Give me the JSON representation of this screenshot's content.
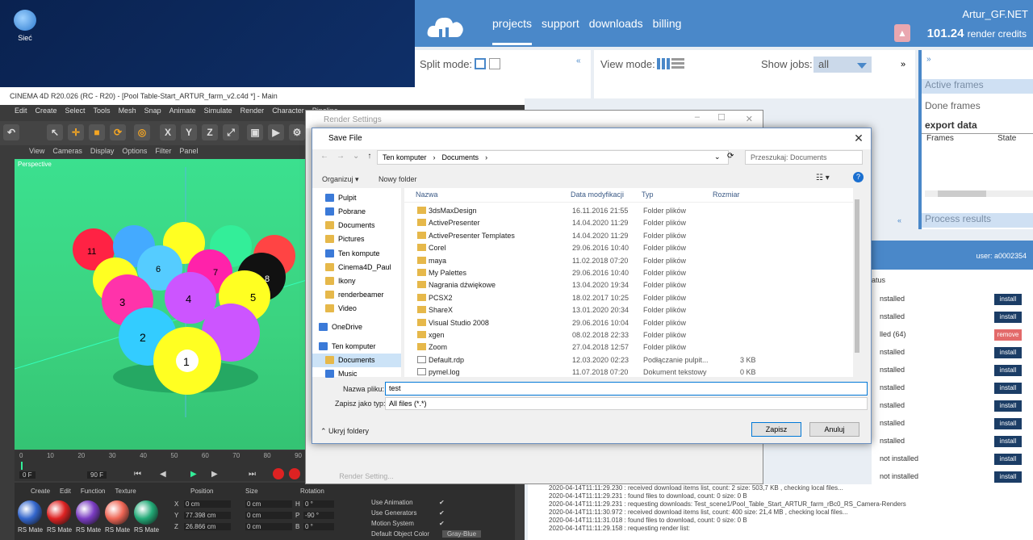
{
  "desktop": {
    "icon_label": "Sieć"
  },
  "web": {
    "nav": [
      "projects",
      "support",
      "downloads",
      "billing"
    ],
    "user": "Artur_GF.NET",
    "credits_value": "101.24",
    "credits_label": "render credits",
    "split_mode_label": "Split mode:",
    "view_mode_label": "View mode:",
    "show_jobs_label": "Show jobs:",
    "show_jobs_value": "all",
    "active_frames": "Active frames",
    "done_frames": "Done frames",
    "export_data": "export data",
    "frames_col": "Frames",
    "state_col": "State",
    "process_results": "Process results",
    "users_user": "user: a0002354",
    "status_col": "atus",
    "user_rows": [
      {
        "status": "nstalled",
        "action": "install"
      },
      {
        "status": "nstalled",
        "action": "install"
      },
      {
        "status": "lled (64)",
        "action": "remove"
      },
      {
        "status": "nstalled",
        "action": "install"
      },
      {
        "status": "nstalled",
        "action": "install"
      },
      {
        "status": "nstalled",
        "action": "install"
      },
      {
        "status": "nstalled",
        "action": "install"
      },
      {
        "status": "nstalled",
        "action": "install"
      },
      {
        "status": "nstalled",
        "action": "install"
      },
      {
        "status": "not installed",
        "action": "install"
      },
      {
        "status": "not installed",
        "action": "install"
      }
    ],
    "log": [
      "2020-04-14T11:11:29.230 : received download items list, count: 2 size: 503,7 KB , checking local files...",
      "2020-04-14T11:11:29.231 : found files to download, count: 0 size: 0 B",
      "2020-04-14T11:11:29.231 : requesting downloads: Test_scene1/Pool_Table_Start_ARTUR_farm_rBc0_RS_Camera-Renders",
      "2020-04-14T11:11:30.972 : received download items list, count: 400 size: 21,4 MB , checking local files...",
      "2020-04-14T11:11:31.018 : found files to download, count: 0 size: 0 B",
      "2020-04-14T11:11:29.158 : requesting render list:"
    ]
  },
  "c4d": {
    "title": "CINEMA 4D R20.026 (RC - R20) - [Pool Table-Start_ARTUR_farm_v2.c4d *] - Main",
    "menu": [
      "Edit",
      "Create",
      "Select",
      "Tools",
      "Mesh",
      "Snap",
      "Animate",
      "Simulate",
      "Render",
      "Character",
      "Pipeline"
    ],
    "viewport_menu": [
      "View",
      "Cameras",
      "Display",
      "Options",
      "Filter",
      "Panel"
    ],
    "viewport_label": "Perspective",
    "ticks": [
      "0",
      "10",
      "20",
      "30",
      "40",
      "50",
      "60",
      "70",
      "80",
      "90"
    ],
    "frame_start": "0 F",
    "frame_end": "90 F",
    "bottom_menu": [
      "Create",
      "Edit",
      "Function",
      "Texture"
    ],
    "materials": [
      "RS Mate",
      "RS Mate",
      "RS Mate",
      "RS Mate",
      "RS Mate"
    ],
    "coords_headers": [
      "Position",
      "Size",
      "Rotation"
    ],
    "coords": [
      {
        "axis": "X",
        "pos": "0 cm",
        "size": "0 cm",
        "rot": "H",
        "rotv": "0 °"
      },
      {
        "axis": "Y",
        "pos": "77.398 cm",
        "size": "0 cm",
        "rot": "P",
        "rotv": "-90 °"
      },
      {
        "axis": "Z",
        "pos": "26.866 cm",
        "size": "0 cm",
        "rot": "B",
        "rotv": "0 °"
      }
    ],
    "attrs": [
      "Use Animation",
      "Use Generators",
      "Motion System",
      "Default Object Color"
    ],
    "default_color_value": "Gray-Blue"
  },
  "render_settings": {
    "title": "Render Settings",
    "button": "Render Setting..."
  },
  "dialog": {
    "title": "Save File",
    "path": [
      "Ten komputer",
      "Documents"
    ],
    "search_placeholder": "Przeszukaj: Documents",
    "organize": "Organizuj ▾",
    "new_folder": "Nowy folder",
    "columns": {
      "name": "Nazwa",
      "date": "Data modyfikacji",
      "type": "Typ",
      "size": "Rozmiar"
    },
    "nav_items": [
      {
        "label": "Pulpit",
        "icon": "blue"
      },
      {
        "label": "Pobrane",
        "icon": "blue"
      },
      {
        "label": "Documents",
        "icon": "doc"
      },
      {
        "label": "Pictures",
        "icon": "doc"
      },
      {
        "label": "Ten kompute",
        "icon": "blue"
      },
      {
        "label": "Cinema4D_Paul",
        "icon": "folder"
      },
      {
        "label": "Ikony",
        "icon": "folder"
      },
      {
        "label": "renderbeamer",
        "icon": "folder"
      },
      {
        "label": "Video",
        "icon": "folder"
      },
      {
        "label": "OneDrive",
        "icon": "blue"
      },
      {
        "label": "Ten komputer",
        "icon": "blue"
      },
      {
        "label": "Documents",
        "icon": "doc"
      },
      {
        "label": "Music",
        "icon": "blue"
      }
    ],
    "files": [
      {
        "name": "3dsMaxDesign",
        "date": "16.11.2016 21:55",
        "type": "Folder plików",
        "size": "",
        "kind": "folder"
      },
      {
        "name": "ActivePresenter",
        "date": "14.04.2020 11:29",
        "type": "Folder plików",
        "size": "",
        "kind": "folder"
      },
      {
        "name": "ActivePresenter Templates",
        "date": "14.04.2020 11:29",
        "type": "Folder plików",
        "size": "",
        "kind": "folder"
      },
      {
        "name": "Corel",
        "date": "29.06.2016 10:40",
        "type": "Folder plików",
        "size": "",
        "kind": "folder"
      },
      {
        "name": "maya",
        "date": "11.02.2018 07:20",
        "type": "Folder plików",
        "size": "",
        "kind": "folder"
      },
      {
        "name": "My Palettes",
        "date": "29.06.2016 10:40",
        "type": "Folder plików",
        "size": "",
        "kind": "folder"
      },
      {
        "name": "Nagrania dźwiękowe",
        "date": "13.04.2020 19:34",
        "type": "Folder plików",
        "size": "",
        "kind": "folder"
      },
      {
        "name": "PCSX2",
        "date": "18.02.2017 10:25",
        "type": "Folder plików",
        "size": "",
        "kind": "folder"
      },
      {
        "name": "ShareX",
        "date": "13.01.2020 20:34",
        "type": "Folder plików",
        "size": "",
        "kind": "folder"
      },
      {
        "name": "Visual Studio 2008",
        "date": "29.06.2016 10:04",
        "type": "Folder plików",
        "size": "",
        "kind": "folder"
      },
      {
        "name": "xgen",
        "date": "08.02.2018 22:33",
        "type": "Folder plików",
        "size": "",
        "kind": "folder"
      },
      {
        "name": "Zoom",
        "date": "27.04.2018 12:57",
        "type": "Folder plików",
        "size": "",
        "kind": "folder"
      },
      {
        "name": "Default.rdp",
        "date": "12.03.2020 02:23",
        "type": "Podłączanie pulpit...",
        "size": "3 KB",
        "kind": "doc"
      },
      {
        "name": "pymel.log",
        "date": "11.07.2018 07:20",
        "type": "Dokument tekstowy",
        "size": "0 KB",
        "kind": "doc"
      }
    ],
    "filename_label": "Nazwa pliku:",
    "filename_value": "test",
    "filetype_label": "Zapisz jako typ:",
    "filetype_value": "All files (*.*)",
    "hide_folders": "Ukryj foldery",
    "save": "Zapisz",
    "cancel": "Anuluj"
  }
}
